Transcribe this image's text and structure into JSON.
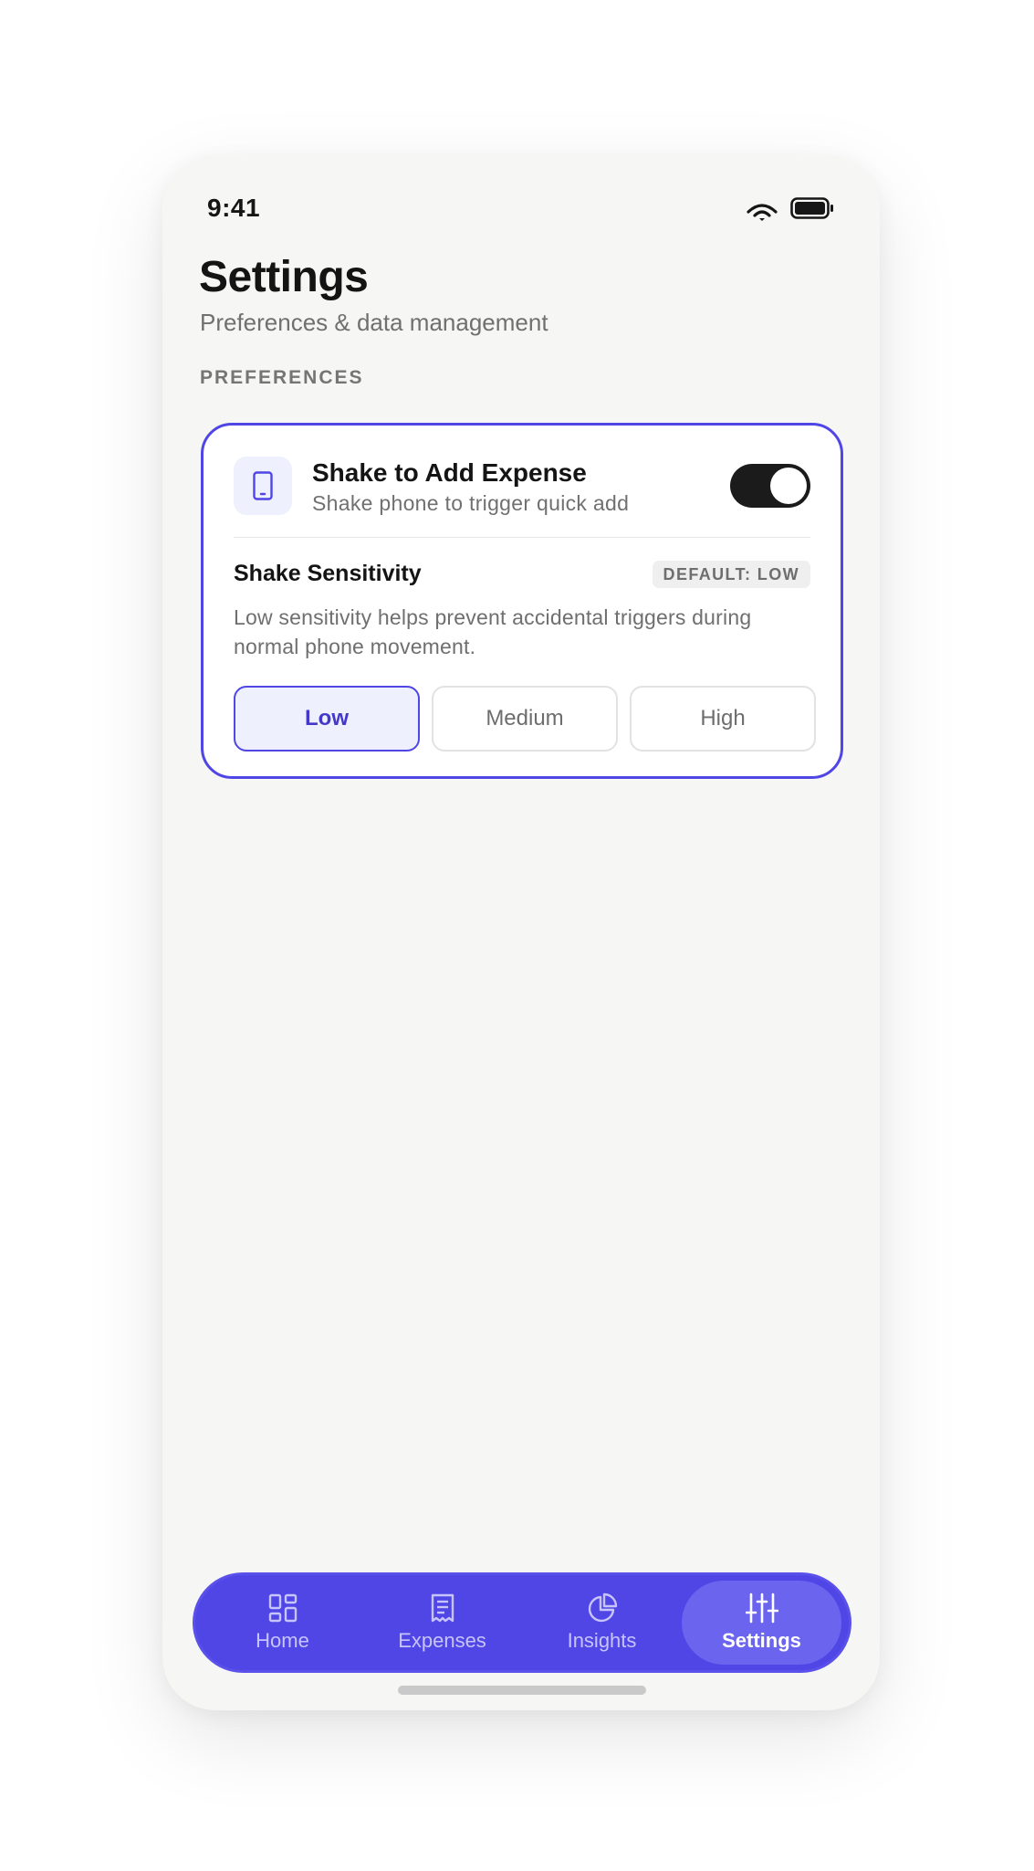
{
  "status_bar": {
    "time": "9:41"
  },
  "header": {
    "title": "Settings",
    "subtitle": "Preferences & data management"
  },
  "sections": {
    "preferences_label": "PREFERENCES"
  },
  "shake_card": {
    "icon": "phone-icon",
    "title": "Shake to Add Expense",
    "description": "Shake phone to trigger quick add",
    "toggle_on": true,
    "sensitivity": {
      "title": "Shake Sensitivity",
      "badge": "DEFAULT: LOW",
      "help": "Low sensitivity helps prevent accidental triggers during normal phone movement.",
      "options": [
        "Low",
        "Medium",
        "High"
      ],
      "selected": "Low"
    }
  },
  "tabbar": {
    "tabs": [
      {
        "label": "Home",
        "icon": "dashboard-icon"
      },
      {
        "label": "Expenses",
        "icon": "receipt-icon"
      },
      {
        "label": "Insights",
        "icon": "pie-chart-icon"
      },
      {
        "label": "Settings",
        "icon": "sliders-icon"
      }
    ],
    "active": "Settings"
  },
  "colors": {
    "accent": "#4f46e5",
    "accent_light": "#eef0fd",
    "background": "#f6f6f4",
    "toggle_on": "#1b1b1b"
  }
}
